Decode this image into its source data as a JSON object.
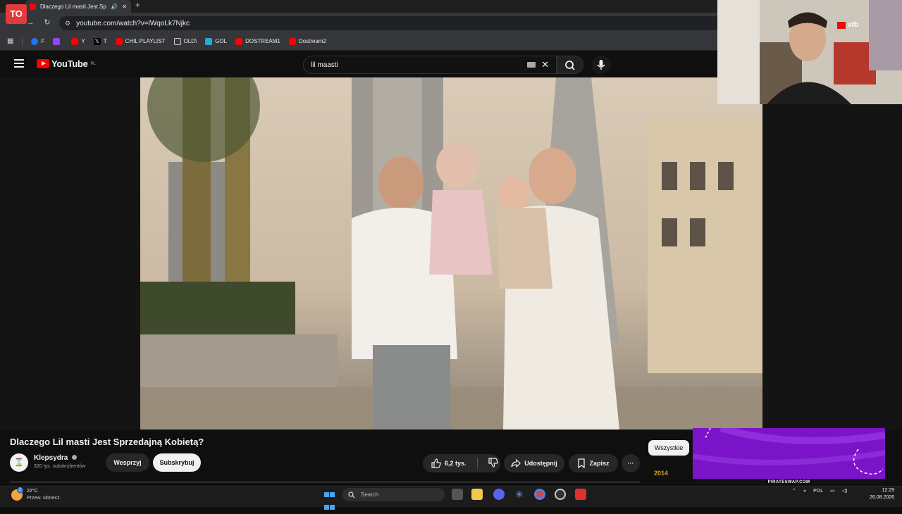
{
  "browser": {
    "tab_title": "Dlaczego Lil masti Jest Sprz",
    "url": "youtube.com/watch?v=lWqoLk7Njkc"
  },
  "bookmarks": [
    {
      "label": "F",
      "color": "#1877f2"
    },
    {
      "label": "",
      "color": "#9146ff"
    },
    {
      "label": "Y",
      "color": "#ff0000"
    },
    {
      "label": "T",
      "color": "#000000"
    },
    {
      "label": "CHIL PLAYLIST",
      "color": "#ff0000"
    },
    {
      "label": "OLD\\",
      "color": "#888888"
    },
    {
      "label": "GOL",
      "color": "#2aa7d6"
    },
    {
      "label": "DOSTREAM1",
      "color": "#ff0000"
    },
    {
      "label": "Dostream2",
      "color": "#ff0000"
    }
  ],
  "youtube": {
    "logo_text": "YouTube",
    "region": "PL",
    "search_query": "lil maasti"
  },
  "overlay": {
    "stream_logo": "TO",
    "sponsor": "xtb"
  },
  "video": {
    "title": "Dlaczego Lil masti Jest Sprzedajną Kobietą?",
    "channel_name": "Klepsydra",
    "channel_initial": "⌛",
    "subscribers": "320 tys. subskrybentów",
    "join_label": "Wesprzyj",
    "subscribe_label": "Subskrybuj",
    "likes": "6,2 tys.",
    "share_label": "Udostępnij",
    "save_label": "Zapisz",
    "more_label": "···"
  },
  "sidebar": {
    "chip_all": "Wszystkie",
    "year": "2014"
  },
  "ad": {
    "text": "PIRATESWAP.COM"
  },
  "taskbar": {
    "weather_badge": "2",
    "temperature": "22°C",
    "condition": "Przew. słonecz.",
    "search_placeholder": "Search",
    "language": "POL",
    "time": "12:29",
    "date": "26.08.2026"
  },
  "colors": {
    "yt_red": "#ff0000",
    "background": "#0f0f0f",
    "ad_purple": "#7b14c9"
  }
}
